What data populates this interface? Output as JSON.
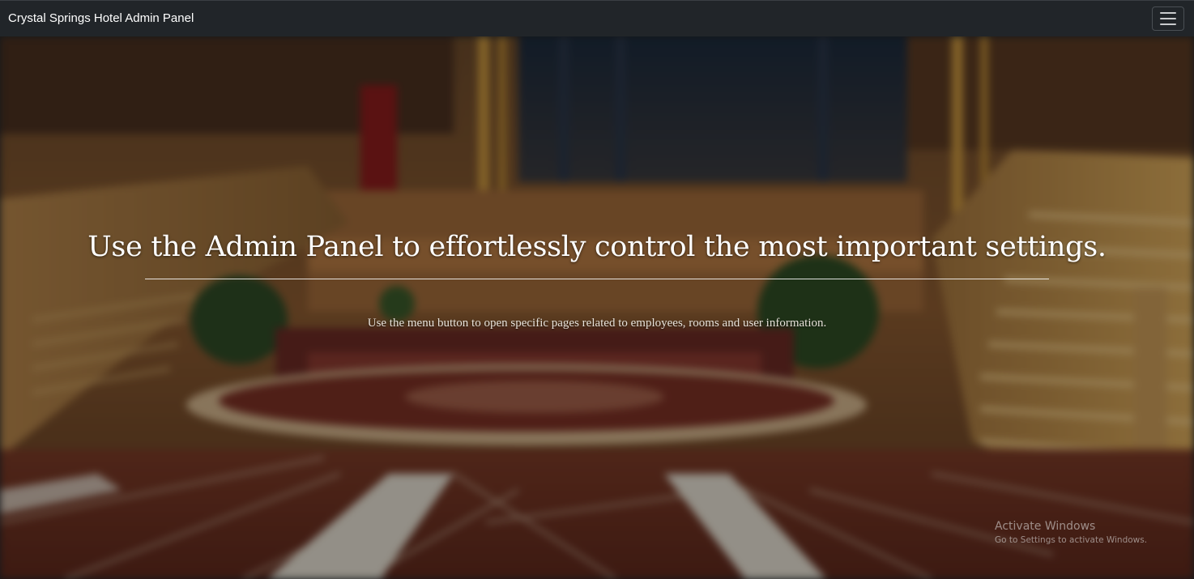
{
  "navbar": {
    "brand": "Crystal Springs Hotel Admin Panel",
    "menu_icon": "hamburger-menu-icon"
  },
  "hero": {
    "headline": "Use the Admin Panel to effortlessly control the most important settings.",
    "subtext": "Use the menu button to open specific pages related to employees, rooms and user information."
  },
  "watermark": {
    "title": "Activate Windows",
    "subtitle": "Go to Settings to activate Windows."
  },
  "colors": {
    "navbar_bg": "#212529",
    "text_primary": "#ffffff"
  }
}
